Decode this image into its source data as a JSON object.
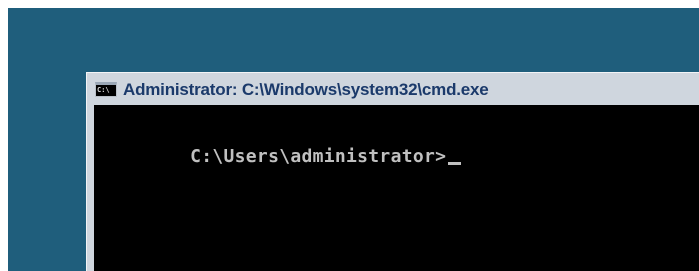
{
  "window": {
    "title": "Administrator: C:\\Windows\\system32\\cmd.exe",
    "icon": "cmd-icon",
    "icon_text": "C:\\"
  },
  "console": {
    "prompt": "C:\\Users\\administrator>"
  },
  "colors": {
    "desktop": "#1f5e7c",
    "title_text": "#1b3a6b",
    "window_frame": "#cfd6de",
    "console_bg": "#000000",
    "console_text": "#c0c0c0"
  }
}
